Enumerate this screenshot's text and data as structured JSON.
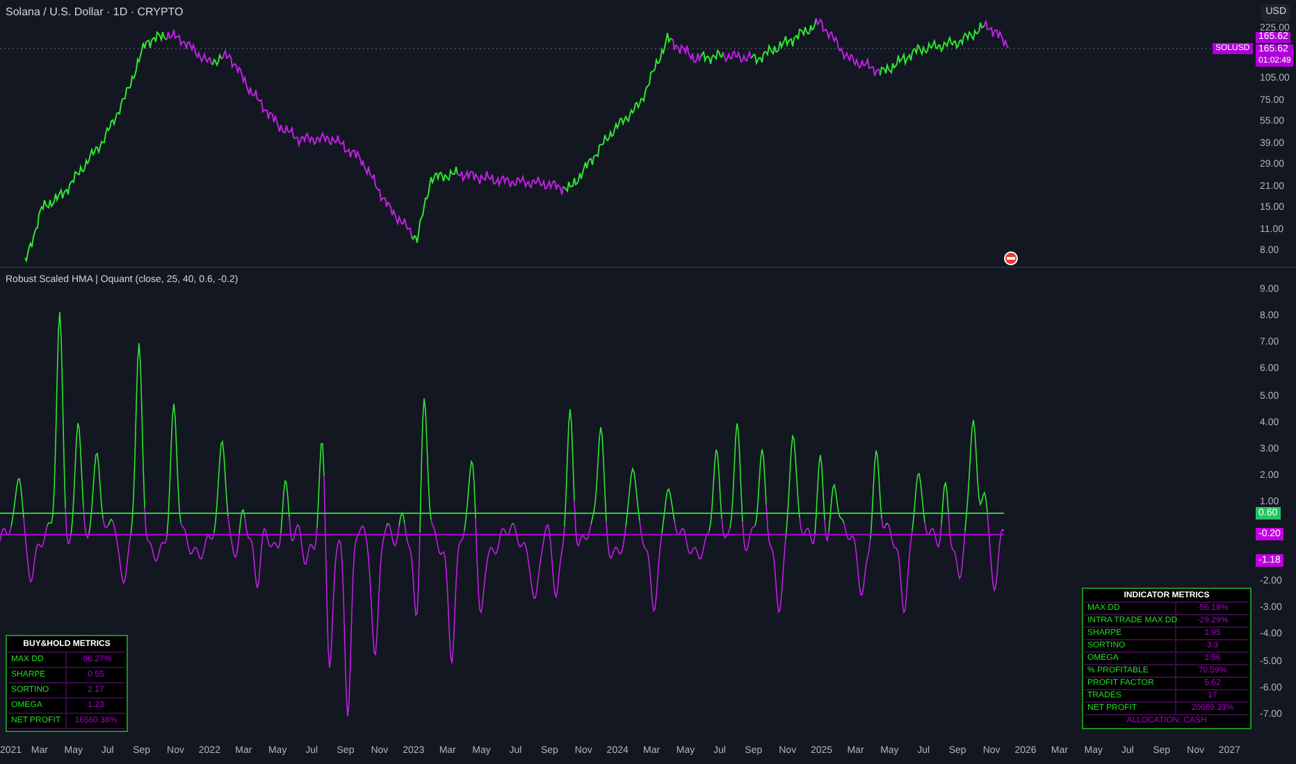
{
  "symbol_title": "Solana / U.S. Dollar · 1D · CRYPTO",
  "currency": "USD",
  "price_axis": [
    "225.00",
    "105.00",
    "75.00",
    "55.00",
    "39.00",
    "29.00",
    "21.00",
    "15.00",
    "11.00",
    "8.00"
  ],
  "price_tags": {
    "symbol": "SOLUSD",
    "last_price": "165.62",
    "close_price": "165.62",
    "countdown": "01:02:49"
  },
  "indicator": {
    "title": "Robust Scaled HMA | Oquant (close, 25, 40, 0.6, -0.2)",
    "axis": [
      "9.00",
      "8.00",
      "7.00",
      "6.00",
      "5.00",
      "4.00",
      "3.00",
      "2.00",
      "1.00",
      "-2.00",
      "-3.00",
      "-4.00",
      "-5.00",
      "-6.00",
      "-7.00"
    ],
    "tags": [
      {
        "text": "0.60",
        "color": "#22c55e"
      },
      {
        "text": "-0.20",
        "color": "#c000e0"
      },
      {
        "text": "-1.18",
        "color": "#c000e0"
      }
    ]
  },
  "time_axis": [
    "2021",
    "Mar",
    "May",
    "Jul",
    "Sep",
    "Nov",
    "2022",
    "Mar",
    "May",
    "Jul",
    "Sep",
    "Nov",
    "2023",
    "Mar",
    "May",
    "Jul",
    "Sep",
    "Nov",
    "2024",
    "Mar",
    "May",
    "Jul",
    "Sep",
    "Nov",
    "2025",
    "Mar",
    "May",
    "Jul",
    "Sep",
    "Nov",
    "2026",
    "Mar",
    "May",
    "Jul",
    "Sep",
    "Nov",
    "2027"
  ],
  "buyhold_table": {
    "title": "BUY&HOLD METRICS",
    "rows": [
      {
        "label": "MAX DD",
        "value": "-96.27%"
      },
      {
        "label": "SHARPE",
        "value": "0.55"
      },
      {
        "label": "SORTINO",
        "value": "2.17"
      },
      {
        "label": "OMEGA",
        "value": "1.23"
      },
      {
        "label": "NET PROFIT",
        "value": "16560.38%"
      }
    ]
  },
  "indicator_table": {
    "title": "INDICATOR METRICS",
    "rows": [
      {
        "label": "MAX DD",
        "value": "-56.18%"
      },
      {
        "label": "INTRA TRADE MAX DD",
        "value": "-29.29%"
      },
      {
        "label": "SHARPE",
        "value": "1.95"
      },
      {
        "label": "SORTINO",
        "value": "3.3"
      },
      {
        "label": "OMEGA",
        "value": "1.56"
      },
      {
        "label": "% PROFITABLE",
        "value": "70.59%"
      },
      {
        "label": "PROFIT FACTOR",
        "value": "5.62"
      },
      {
        "label": "TRADES",
        "value": "17"
      },
      {
        "label": "NET PROFIT",
        "value": "20669.33%"
      }
    ],
    "footer": "ALLOCATION: CASH"
  }
}
